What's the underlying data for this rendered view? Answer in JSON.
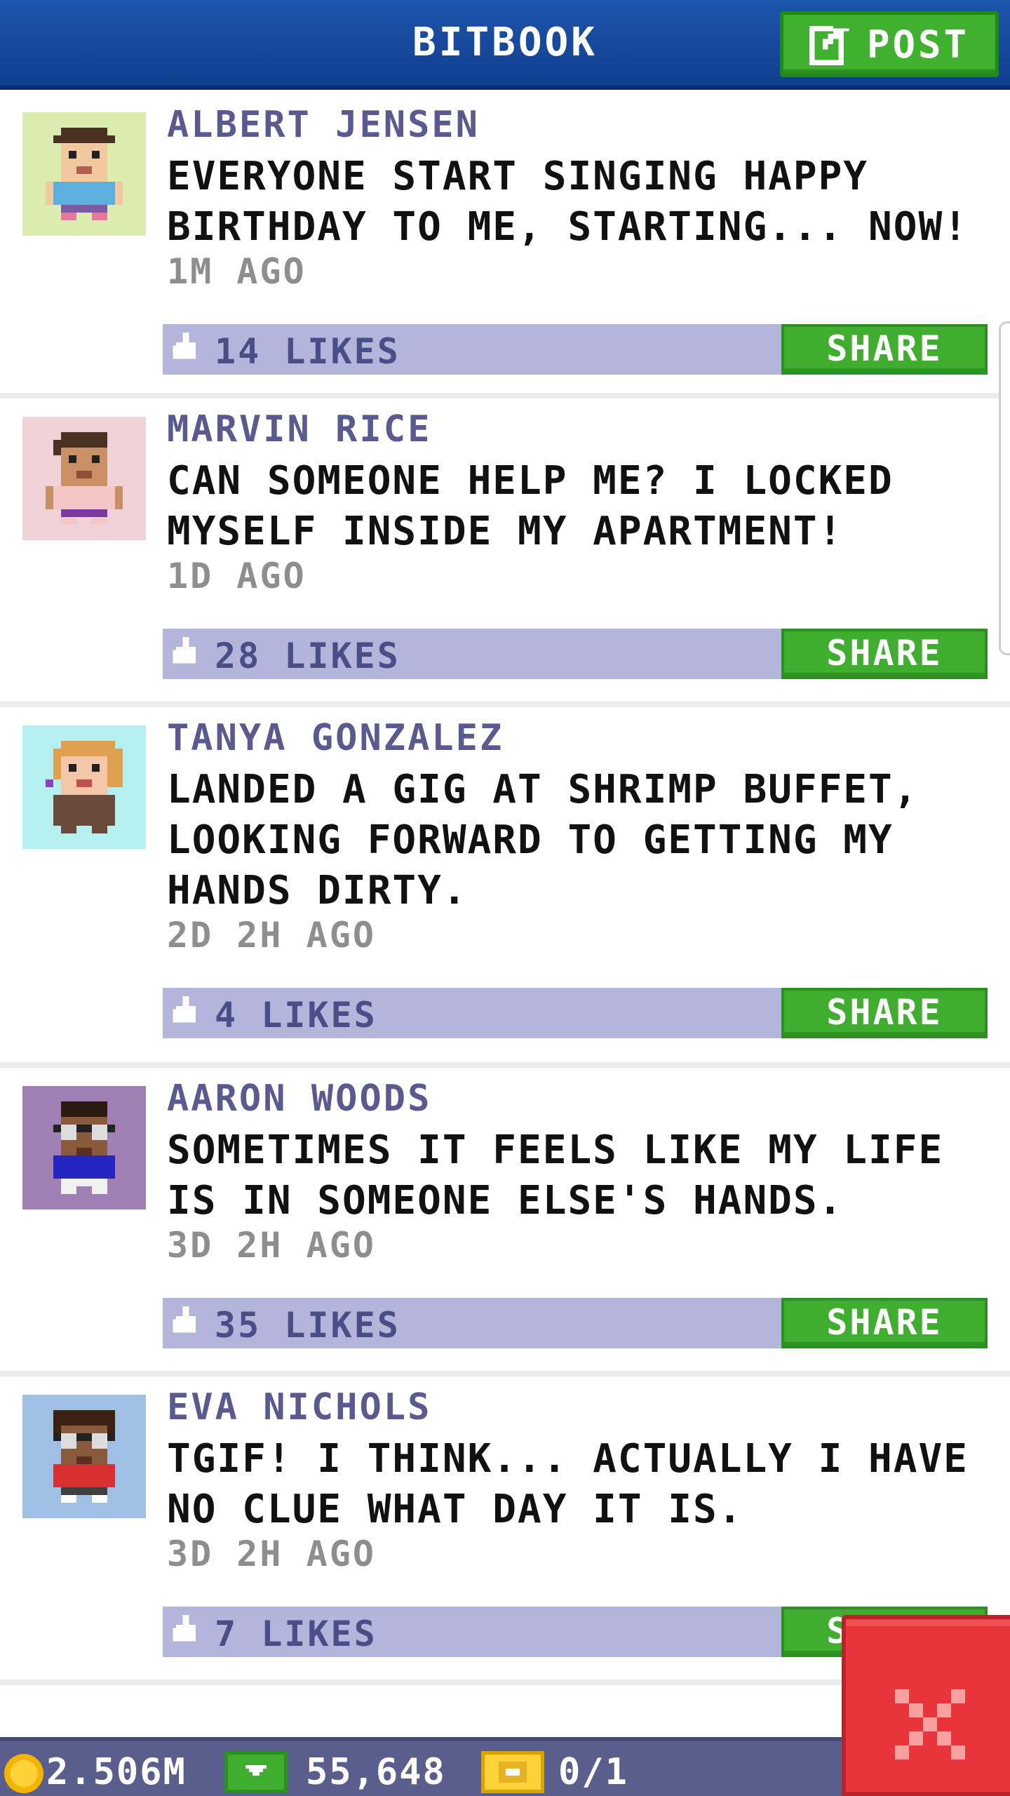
{
  "header": {
    "title": "BITBOOK",
    "post_label": "POST"
  },
  "posts": [
    {
      "name": "ALBERT JENSEN",
      "text": "EVERYONE START SINGING HAPPY BIRTHDAY TO ME, STARTING... NOW!",
      "time": "1M AGO",
      "likes": "14 LIKES",
      "share_label": "SHARE",
      "avatar_bg": "#dbecb0"
    },
    {
      "name": "MARVIN RICE",
      "text": "CAN SOMEONE HELP ME? I LOCKED MYSELF INSIDE MY APARTMENT!",
      "time": "1D AGO",
      "likes": "28 LIKES",
      "share_label": "SHARE",
      "avatar_bg": "#efd3d8"
    },
    {
      "name": "TANYA GONZALEZ",
      "text": "LANDED A GIG AT SHRIMP BUFFET, LOOKING FORWARD TO GETTING MY HANDS DIRTY.",
      "time": "2D 2H AGO",
      "likes": "4 LIKES",
      "share_label": "SHARE",
      "avatar_bg": "#b3f0ef"
    },
    {
      "name": "AARON WOODS",
      "text": "SOMETIMES IT FEELS LIKE MY LIFE IS IN SOMEONE ELSE'S HANDS.",
      "time": "3D 2H AGO",
      "likes": "35 LIKES",
      "share_label": "SHARE",
      "avatar_bg": "#a07fb4"
    },
    {
      "name": "EVA NICHOLS",
      "text": "TGIF! I THINK... ACTUALLY I HAVE NO CLUE WHAT DAY IT IS.",
      "time": "3D 2H AGO",
      "likes": "7 LIKES",
      "share_label": "SHARE",
      "avatar_bg": "#9fbfe4"
    }
  ],
  "bottom_bar": {
    "coins": "2.506M",
    "cash": "55,648",
    "tickets": "0/1"
  },
  "colors": {
    "header_blue": "#1a4ea6",
    "accent_green": "#3fae2e",
    "likes_bar": "#b3b6da",
    "close_red": "#e8343a"
  },
  "icons": {
    "post": "edit-icon",
    "likes": "thumbs-up-icon",
    "coin": "coin-icon",
    "cash": "cash-icon",
    "ticket": "ticket-icon",
    "close": "close-icon"
  }
}
